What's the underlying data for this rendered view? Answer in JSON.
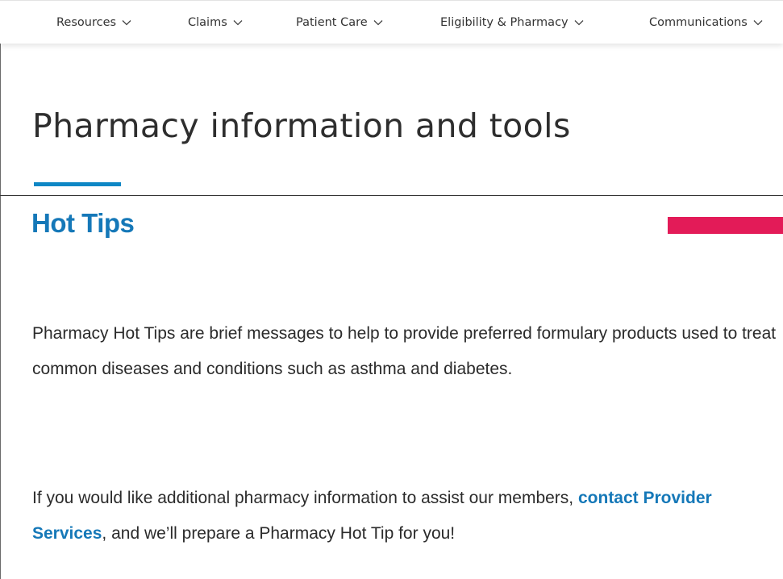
{
  "nav": {
    "items": [
      {
        "label": "Resources"
      },
      {
        "label": "Claims"
      },
      {
        "label": "Patient Care"
      },
      {
        "label": "Eligibility & Pharmacy"
      },
      {
        "label": "Communications"
      }
    ]
  },
  "header": {
    "title": "Pharmacy information and tools"
  },
  "content": {
    "heading": "Hot Tips",
    "paragraph1": "Pharmacy Hot Tips are brief messages to help to provide preferred formulary products used to treat common diseases and conditions such as asthma and diabetes.",
    "paragraph2_before": "If you would like additional pharmacy information to assist our members, ",
    "paragraph2_link": "contact Provider Services",
    "paragraph2_after": ", and we’ll prepare a Pharmacy Hot Tip for you!"
  },
  "colors": {
    "accent_blue": "#0e87c5",
    "heading_blue": "#1578b8",
    "accent_pink": "#e31b58"
  },
  "icons": {
    "nav_chevron": "chevron-down-icon"
  }
}
